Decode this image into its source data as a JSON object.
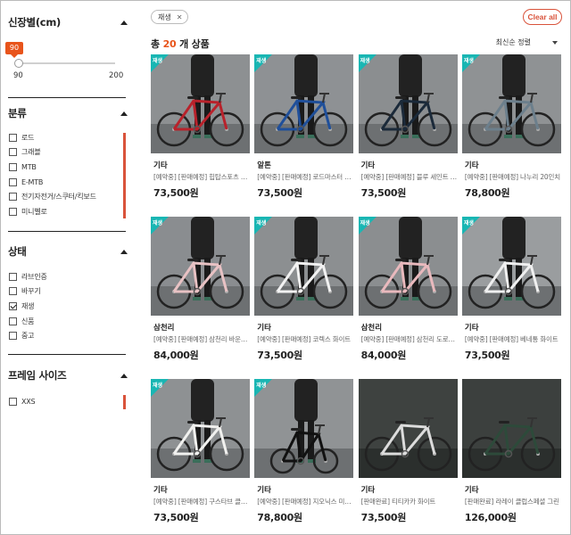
{
  "sidebar": {
    "height_section": {
      "title": "신장별(cm)",
      "value": "90",
      "min": "90",
      "max": "200"
    },
    "category_section": {
      "title": "분류",
      "items": [
        {
          "label": "로드",
          "checked": false
        },
        {
          "label": "그래블",
          "checked": false
        },
        {
          "label": "MTB",
          "checked": false
        },
        {
          "label": "E-MTB",
          "checked": false
        },
        {
          "label": "전기자전거/스쿠터/킥보드",
          "checked": false
        },
        {
          "label": "미니벨로",
          "checked": false
        }
      ]
    },
    "status_section": {
      "title": "상태",
      "items": [
        {
          "label": "라브인증",
          "checked": false
        },
        {
          "label": "바꾸기",
          "checked": false
        },
        {
          "label": "재생",
          "checked": true
        },
        {
          "label": "신품",
          "checked": false
        },
        {
          "label": "중고",
          "checked": false
        }
      ]
    },
    "frame_section": {
      "title": "프레임 사이즈",
      "items": [
        {
          "label": "XXS",
          "checked": false
        }
      ]
    }
  },
  "filters": {
    "active_chip": "재생",
    "clear_label": "Clear all"
  },
  "results": {
    "prefix": "총",
    "count": "20",
    "suffix": "개 상품",
    "sort_label": "최신순 정렬"
  },
  "products": [
    {
      "tag": "재생",
      "brand": "기타",
      "name": "[예약중] [판매예정] 힙탑스포츠 레드",
      "price": "73,500원",
      "frame_color": "#b8222b",
      "bg": "#8d9092"
    },
    {
      "tag": "재생",
      "brand": "알톤",
      "name": "[예약중] [판매예정] 로드마스터 블루",
      "price": "73,500원",
      "frame_color": "#1f4f9a",
      "bg": "#8e9194"
    },
    {
      "tag": "재생",
      "brand": "기타",
      "name": "[예약중] [판매예정] 블루 세인트 블랙",
      "price": "73,500원",
      "frame_color": "#1b2a3a",
      "bg": "#8b8e90"
    },
    {
      "tag": "재생",
      "brand": "기타",
      "name": "[예약중] [판매예정] 나누리 20인치",
      "price": "78,800원",
      "frame_color": "#6c7f8c",
      "bg": "#8f9294"
    },
    {
      "tag": "재생",
      "brand": "삼천리",
      "name": "[예약중] [판매예정] 삼천리 바운스 핑크",
      "price": "84,000원",
      "frame_color": "#e8c2c4",
      "bg": "#8a8d90"
    },
    {
      "tag": "재생",
      "brand": "기타",
      "name": "[예약중] [판매예정] 코렉스 화이트",
      "price": "73,500원",
      "frame_color": "#f2f2f2",
      "bg": "#8c8f91"
    },
    {
      "tag": "재생",
      "brand": "삼천리",
      "name": "[예약중] [판매예정] 삼천리 도로시 핑크",
      "price": "84,000원",
      "frame_color": "#e9b9bd",
      "bg": "#8b8e90"
    },
    {
      "tag": "재생",
      "brand": "기타",
      "name": "[예약중] [판매예정] 베네통 화이트",
      "price": "73,500원",
      "frame_color": "#f0f0f0",
      "bg": "#9a9d9f"
    },
    {
      "tag": "재생",
      "brand": "기타",
      "name": "[예약중] [판매예정] 구스타브 클래식",
      "price": "73,500원",
      "frame_color": "#f1f1ef",
      "bg": "#8e9193"
    },
    {
      "tag": "재생",
      "brand": "기타",
      "name": "[예약중] [판매예정] 지오닉스 미니벨로",
      "price": "78,800원",
      "frame_color": "#111111",
      "bg": "#909395"
    },
    {
      "tag": "",
      "brand": "기타",
      "name": "[판매완료] 티티카카 화이트",
      "price": "73,500원",
      "frame_color": "#dcdcdc",
      "bg": "#3e4240"
    },
    {
      "tag": "",
      "brand": "기타",
      "name": "[판매완료] 라레이 클럽스페셜 그린",
      "price": "126,000원",
      "frame_color": "#2d4a3a",
      "bg": "#3c403e"
    }
  ]
}
